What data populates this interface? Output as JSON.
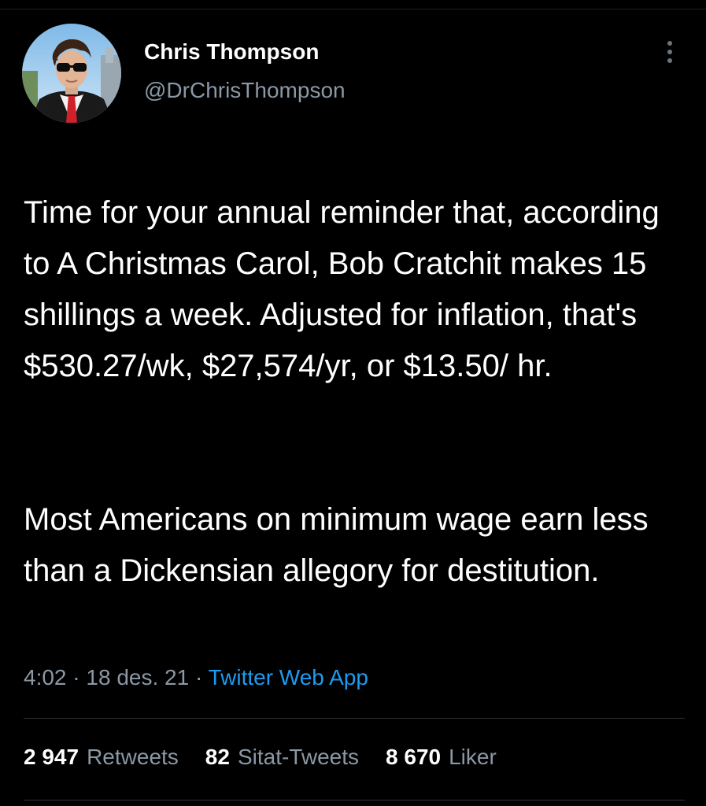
{
  "author": {
    "display_name": "Chris Thompson",
    "handle": "@DrChrisThompson"
  },
  "tweet": {
    "paragraphs": [
      "Time for your annual reminder that, according to A Christmas Carol, Bob Cratchit makes 15 shillings a week. Adjusted for inflation, that's $530.27/wk, $27,574/yr, or $13.50/ hr.",
      "Most Americans on minimum wage earn less than a Dickensian allegory for destitution."
    ],
    "time": "4:02",
    "date": "18 des. 21",
    "separator": "·",
    "source": "Twitter Web App"
  },
  "stats": {
    "retweets": {
      "count": "2 947",
      "label": "Retweets"
    },
    "quote_tweets": {
      "count": "82",
      "label": "Sitat-Tweets"
    },
    "likes": {
      "count": "8 670",
      "label": "Liker"
    }
  },
  "icons": {
    "more": "more-options-icon",
    "avatar": "profile-photo"
  },
  "colors": {
    "background": "#000000",
    "text": "#ffffff",
    "secondary": "#8b98a5",
    "accent": "#1d9bf0",
    "divider": "#2f3336"
  }
}
